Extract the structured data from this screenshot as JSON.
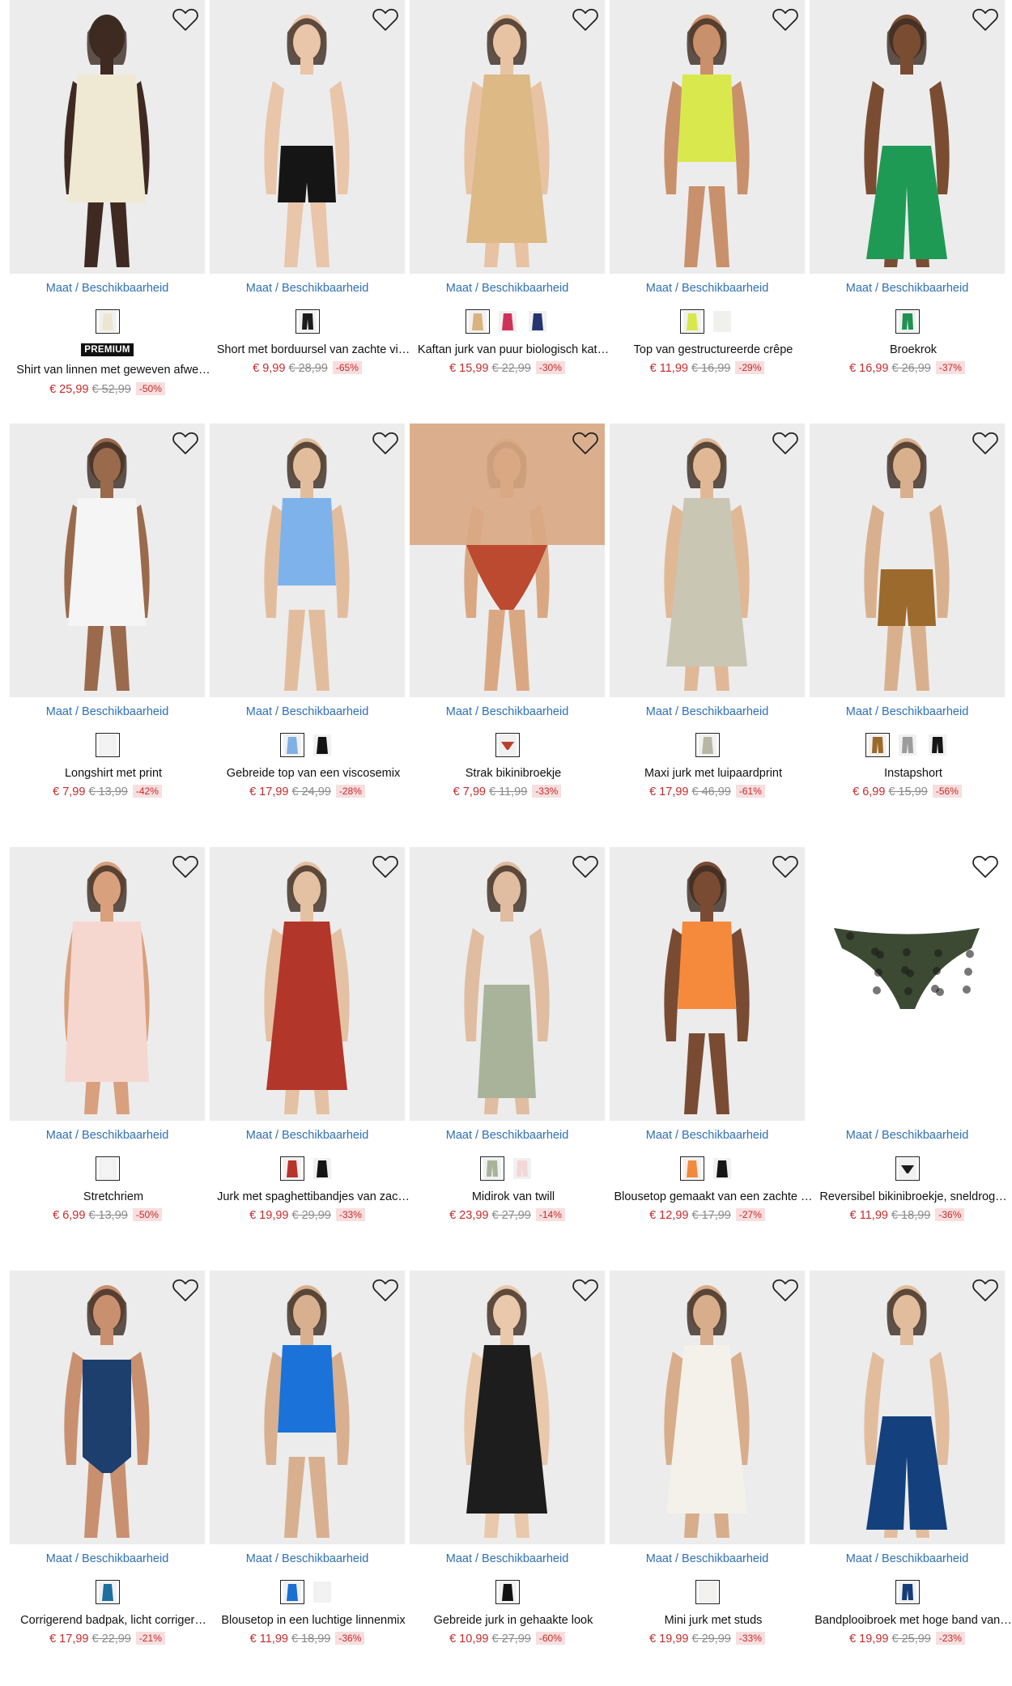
{
  "size_link_label": "Maat / Beschikbaarheid",
  "colors": {
    "link": "#2e6fb8",
    "price": "#c62b2b",
    "discount_bg": "#f8dede"
  },
  "products": [
    {
      "name": "Shirt van linnen met geweven afwe…",
      "badge": "PREMIUM",
      "price": "€ 25,99",
      "old_price": "€ 52,99",
      "discount": "-50%",
      "swatches": [
        "#ece5cf"
      ],
      "garment": "#efe9d4",
      "skin": "#3f2a22",
      "kind": "tunic",
      "icon": "linen-shirt"
    },
    {
      "name": "Short met borduursel van zachte vi…",
      "badge": "",
      "price": "€ 9,99",
      "old_price": "€ 28,99",
      "discount": "-65%",
      "swatches": [
        "#1b1b1b"
      ],
      "garment": "#151515",
      "skin": "#e9c5aa",
      "kind": "shorts",
      "icon": "shorts"
    },
    {
      "name": "Kaftan jurk van puur biologisch kat…",
      "badge": "",
      "price": "€ 15,99",
      "old_price": "€ 22,99",
      "discount": "-30%",
      "swatches": [
        "#d9b27e",
        "#d0315a",
        "#25346e"
      ],
      "garment": "#dcb985",
      "skin": "#e8c3a3",
      "kind": "dress",
      "icon": "kaftan"
    },
    {
      "name": "Top van gestructureerde crêpe",
      "badge": "",
      "price": "€ 11,99",
      "old_price": "€ 16,99",
      "discount": "-29%",
      "swatches": [
        "#d8e84a",
        "#f1f1ec"
      ],
      "garment": "#d9e94d",
      "skin": "#c9906c",
      "kind": "top",
      "icon": "top"
    },
    {
      "name": "Broekrok",
      "badge": "",
      "price": "€ 16,99",
      "old_price": "€ 26,99",
      "discount": "-37%",
      "swatches": [
        "#1f9150"
      ],
      "garment": "#1f9a55",
      "skin": "#7a4d33",
      "kind": "pants",
      "icon": "culottes"
    },
    {
      "name": "Longshirt met print",
      "badge": "",
      "price": "€ 7,99",
      "old_price": "€ 13,99",
      "discount": "-42%",
      "swatches": [
        "#f3f3f3"
      ],
      "garment": "#f5f5f5",
      "skin": "#9a6a4d",
      "kind": "tunic",
      "icon": "longshirt"
    },
    {
      "name": "Gebreide top van een viscosemix",
      "badge": "",
      "price": "€ 17,99",
      "old_price": "€ 24,99",
      "discount": "-28%",
      "swatches": [
        "#7fb0e6",
        "#121212"
      ],
      "garment": "#7eb2ea",
      "skin": "#e2bd9d",
      "kind": "top",
      "icon": "knit-top"
    },
    {
      "name": "Strak bikinibroekje",
      "badge": "",
      "price": "€ 7,99",
      "old_price": "€ 11,99",
      "discount": "-33%",
      "swatches": [
        "#b8402c"
      ],
      "garment": "#bb4a30",
      "skin": "#d9a883",
      "kind": "bikini",
      "icon": "bikini"
    },
    {
      "name": "Maxi jurk met luipaardprint",
      "badge": "",
      "price": "€ 17,99",
      "old_price": "€ 46,99",
      "discount": "-61%",
      "swatches": [
        "#b9b6a6"
      ],
      "garment": "#c9c6b4",
      "skin": "#e0b896",
      "kind": "dress",
      "icon": "maxi-dress"
    },
    {
      "name": "Instapshort",
      "badge": "",
      "price": "€ 6,99",
      "old_price": "€ 15,99",
      "discount": "-56%",
      "swatches": [
        "#9b6a2a",
        "#9c9c9c",
        "#151515"
      ],
      "garment": "#9b6a2c",
      "skin": "#d9b08e",
      "kind": "shorts",
      "icon": "shorts"
    },
    {
      "name": "Stretchriem",
      "badge": "",
      "price": "€ 6,99",
      "old_price": "€ 13,99",
      "discount": "-50%",
      "swatches": [
        "#f4f4f4"
      ],
      "garment": "#f6d7cf",
      "skin": "#d8a07c",
      "kind": "blazer",
      "icon": "belt"
    },
    {
      "name": "Jurk met spaghettibandjes van zac…",
      "badge": "",
      "price": "€ 19,99",
      "old_price": "€ 29,99",
      "discount": "-33%",
      "swatches": [
        "#b8342a",
        "#141414"
      ],
      "garment": "#b3362a",
      "skin": "#e4c1a3",
      "kind": "dress",
      "icon": "slip-dress"
    },
    {
      "name": "Midirok van twill",
      "badge": "",
      "price": "€ 23,99",
      "old_price": "€ 27,99",
      "discount": "-14%",
      "swatches": [
        "#a9b39a",
        "#f5d6d6"
      ],
      "garment": "#a8b39a",
      "skin": "#e0bca0",
      "kind": "skirt",
      "icon": "skirt"
    },
    {
      "name": "Blousetop gemaakt van een zachte …",
      "badge": "",
      "price": "€ 12,99",
      "old_price": "€ 17,99",
      "discount": "-27%",
      "swatches": [
        "#f28a3d",
        "#151515"
      ],
      "garment": "#f58a3c",
      "skin": "#7a4b33",
      "kind": "top",
      "icon": "blouse"
    },
    {
      "name": "Reversibel bikinibroekje, sneldrog…",
      "badge": "",
      "price": "€ 11,99",
      "old_price": "€ 18,99",
      "discount": "-36%",
      "swatches": [
        "#1c1c1c"
      ],
      "garment": "#3c4a33",
      "skin": "#ffffff",
      "kind": "flatbikini",
      "icon": "bikini"
    },
    {
      "name": "Corrigerend badpak, licht corriger…",
      "badge": "",
      "price": "€ 17,99",
      "old_price": "€ 22,99",
      "discount": "-21%",
      "swatches": [
        "#1e6ea0"
      ],
      "garment": "#1c3f6e",
      "skin": "#c99070",
      "kind": "swimsuit",
      "icon": "swimsuit"
    },
    {
      "name": "Blousetop in een luchtige linnenmix",
      "badge": "",
      "price": "€ 11,99",
      "old_price": "€ 18,99",
      "discount": "-36%",
      "swatches": [
        "#1a6fd3",
        "#f2f2f2"
      ],
      "garment": "#1b73d9",
      "skin": "#d8b08f",
      "kind": "top",
      "icon": "blouse"
    },
    {
      "name": "Gebreide jurk in gehaakte look",
      "badge": "",
      "price": "€ 10,99",
      "old_price": "€ 27,99",
      "discount": "-60%",
      "swatches": [
        "#121212"
      ],
      "garment": "#1d1d1d",
      "skin": "#e9c8ab",
      "kind": "dress",
      "icon": "knit-dress"
    },
    {
      "name": "Mini jurk met studs",
      "badge": "",
      "price": "€ 19,99",
      "old_price": "€ 29,99",
      "discount": "-33%",
      "swatches": [
        "#f4f2ec"
      ],
      "garment": "#f4f1ea",
      "skin": "#d7ad8b",
      "kind": "dress",
      "icon": "mini-dress"
    },
    {
      "name": "Bandplooibroek met hoge band van…",
      "badge": "",
      "price": "€ 19,99",
      "old_price": "€ 25,99",
      "discount": "-23%",
      "swatches": [
        "#153c78"
      ],
      "garment": "#15407e",
      "skin": "#e2bd9d",
      "kind": "pants",
      "icon": "wide-pants"
    }
  ]
}
